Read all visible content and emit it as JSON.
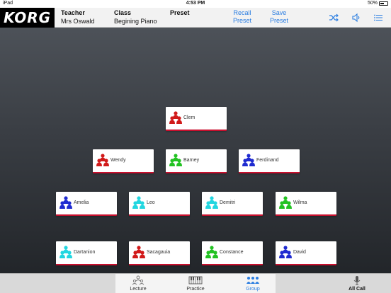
{
  "status_bar": {
    "device": "iPad",
    "time": "4:53 PM",
    "battery": "50%"
  },
  "header": {
    "logo": "KORG",
    "teacher_label": "Teacher",
    "teacher_value": "Mrs Oswald",
    "class_label": "Class",
    "class_value": "Begining Piano",
    "preset_label": "Preset",
    "recall_label": "Recall\nPreset",
    "save_label": "Save\nPreset",
    "icons": [
      "shuffle-icon",
      "speaker-icon",
      "menu-icon"
    ]
  },
  "students": [
    {
      "name": "Clem",
      "color": "#d11a1a"
    },
    {
      "name": "Wendy",
      "color": "#d11a1a"
    },
    {
      "name": "Barney",
      "color": "#22c222"
    },
    {
      "name": "Ferdinand",
      "color": "#1f2bd0"
    },
    {
      "name": "Amelia",
      "color": "#1f2bd0"
    },
    {
      "name": "Leo",
      "color": "#22d6e0"
    },
    {
      "name": "Demitri",
      "color": "#22d6e0"
    },
    {
      "name": "Wilma",
      "color": "#22c222"
    },
    {
      "name": "Dartanion",
      "color": "#22d6e0"
    },
    {
      "name": "Sacagauia",
      "color": "#d11a1a"
    },
    {
      "name": "Constance",
      "color": "#22c222"
    },
    {
      "name": "David",
      "color": "#1f2bd0"
    }
  ],
  "tabs": [
    {
      "label": "Lecture",
      "active": false
    },
    {
      "label": "Practice",
      "active": false
    },
    {
      "label": "Group",
      "active": true
    },
    {
      "label": "All Call",
      "active": false
    }
  ],
  "colors": {
    "accent": "#2a7de1",
    "card_border": "#c8102e"
  }
}
